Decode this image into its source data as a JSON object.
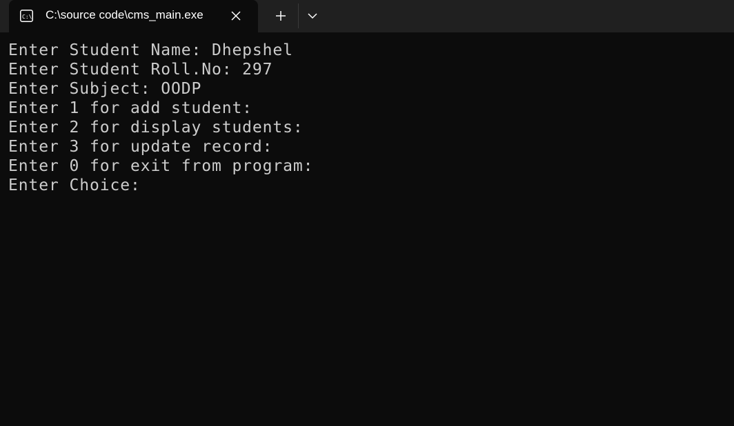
{
  "window": {
    "tab_title": "C:\\source code\\cms_main.exe",
    "tab_icon": "terminal-icon",
    "close_icon": "close-icon",
    "new_tab_icon": "plus-icon",
    "dropdown_icon": "chevron-down-icon"
  },
  "colors": {
    "titlebar_bg": "#202020",
    "terminal_bg": "#0c0c0c",
    "text": "#cccccc"
  },
  "terminal": {
    "lines": [
      "Enter Student Name: Dhepshel",
      "Enter Student Roll.No: 297",
      "Enter Subject: OODP",
      "Enter 1 for add student:",
      "Enter 2 for display students:",
      "Enter 3 for update record:",
      "Enter 0 for exit from program:",
      "Enter Choice:"
    ]
  }
}
